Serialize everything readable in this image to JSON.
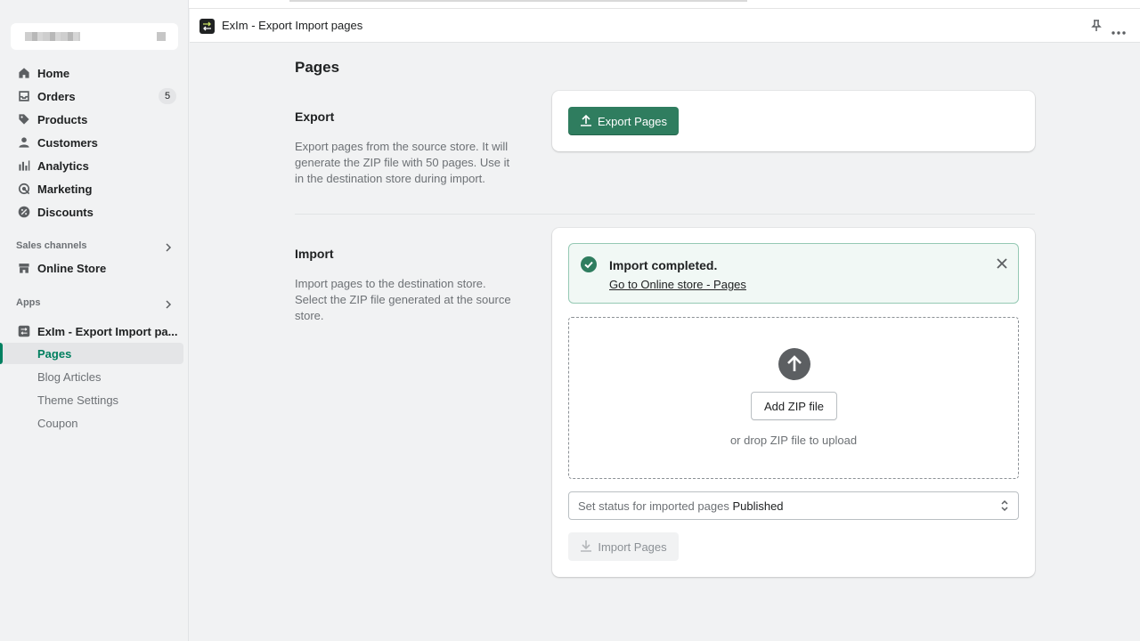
{
  "sidebar": {
    "nav": [
      {
        "label": "Home",
        "icon": "home-icon"
      },
      {
        "label": "Orders",
        "icon": "orders-icon",
        "badge": "5"
      },
      {
        "label": "Products",
        "icon": "tag-icon"
      },
      {
        "label": "Customers",
        "icon": "person-icon"
      },
      {
        "label": "Analytics",
        "icon": "bar-chart-icon"
      },
      {
        "label": "Marketing",
        "icon": "target-icon"
      },
      {
        "label": "Discounts",
        "icon": "discount-icon"
      }
    ],
    "sales_channels_label": "Sales channels",
    "online_store_label": "Online Store",
    "apps_label": "Apps",
    "app_name": "ExIm - Export Import pa...",
    "app_sub": [
      {
        "label": "Pages",
        "active": true
      },
      {
        "label": "Blog Articles"
      },
      {
        "label": "Theme Settings"
      },
      {
        "label": "Coupon"
      }
    ]
  },
  "topbar": {
    "title": "ExIm - Export Import pages"
  },
  "main": {
    "page_title": "Pages",
    "export": {
      "title": "Export",
      "description": "Export pages from the source store. It will generate the ZIP file with 50 pages. Use it in the destination store during import.",
      "button_label": "Export Pages"
    },
    "import": {
      "title": "Import",
      "description": "Import pages to the destination store. Select the ZIP file generated at the source store.",
      "banner_title": "Import completed.",
      "banner_link": "Go to Online store - Pages",
      "add_zip_label": "Add ZIP file",
      "drop_hint": "or drop ZIP file to upload",
      "status_prefix": "Set status for imported pages",
      "status_value": "Published",
      "import_button_label": "Import Pages"
    }
  },
  "colors": {
    "primary": "#2f7d5f",
    "success_bg": "#f1f8f5",
    "success_border": "#95c9b4"
  }
}
